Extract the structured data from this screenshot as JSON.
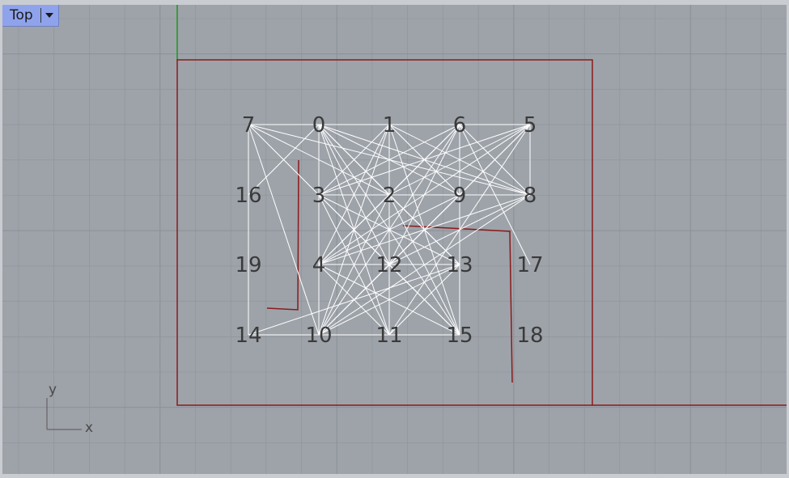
{
  "viewport": {
    "title": "Top",
    "menu_icon": "chevron-down-icon"
  },
  "axis_widget": {
    "x_label": "x",
    "y_label": "y"
  },
  "colors": {
    "background": "#9ea3aa",
    "grid": "#8d9299",
    "edges": "#ffffff",
    "curves": "#8b1a1a",
    "y_axis": "#3c9a3c"
  },
  "nodes": [
    {
      "id": "0",
      "label": "0"
    },
    {
      "id": "1",
      "label": "1"
    },
    {
      "id": "2",
      "label": "2"
    },
    {
      "id": "3",
      "label": "3"
    },
    {
      "id": "4",
      "label": "4"
    },
    {
      "id": "5",
      "label": "5"
    },
    {
      "id": "6",
      "label": "6"
    },
    {
      "id": "7",
      "label": "7"
    },
    {
      "id": "8",
      "label": "8"
    },
    {
      "id": "9",
      "label": "9"
    },
    {
      "id": "10",
      "label": "10"
    },
    {
      "id": "11",
      "label": "11"
    },
    {
      "id": "12",
      "label": "12"
    },
    {
      "id": "13",
      "label": "13"
    },
    {
      "id": "14",
      "label": "14"
    },
    {
      "id": "15",
      "label": "15"
    },
    {
      "id": "16",
      "label": "16"
    },
    {
      "id": "17",
      "label": "17"
    },
    {
      "id": "18",
      "label": "18"
    },
    {
      "id": "19",
      "label": "19"
    }
  ],
  "edges": [
    [
      "7",
      "0"
    ],
    [
      "0",
      "1"
    ],
    [
      "1",
      "6"
    ],
    [
      "6",
      "5"
    ],
    [
      "7",
      "10"
    ],
    [
      "7",
      "3"
    ],
    [
      "7",
      "2"
    ],
    [
      "7",
      "8"
    ],
    [
      "7",
      "14"
    ],
    [
      "0",
      "16"
    ],
    [
      "0",
      "3"
    ],
    [
      "0",
      "2"
    ],
    [
      "0",
      "9"
    ],
    [
      "0",
      "8"
    ],
    [
      "0",
      "12"
    ],
    [
      "0",
      "13"
    ],
    [
      "0",
      "11"
    ],
    [
      "0",
      "15"
    ],
    [
      "1",
      "3"
    ],
    [
      "1",
      "2"
    ],
    [
      "1",
      "9"
    ],
    [
      "1",
      "8"
    ],
    [
      "1",
      "12"
    ],
    [
      "1",
      "4"
    ],
    [
      "1",
      "10"
    ],
    [
      "1",
      "15"
    ],
    [
      "6",
      "3"
    ],
    [
      "6",
      "2"
    ],
    [
      "6",
      "9"
    ],
    [
      "6",
      "8"
    ],
    [
      "6",
      "4"
    ],
    [
      "6",
      "10"
    ],
    [
      "6",
      "12"
    ],
    [
      "6",
      "17"
    ],
    [
      "5",
      "3"
    ],
    [
      "5",
      "2"
    ],
    [
      "5",
      "9"
    ],
    [
      "5",
      "8"
    ],
    [
      "5",
      "4"
    ],
    [
      "5",
      "10"
    ],
    [
      "5",
      "11"
    ],
    [
      "3",
      "2"
    ],
    [
      "2",
      "9"
    ],
    [
      "9",
      "8"
    ],
    [
      "3",
      "8"
    ],
    [
      "3",
      "4"
    ],
    [
      "3",
      "12"
    ],
    [
      "3",
      "11"
    ],
    [
      "3",
      "15"
    ],
    [
      "3",
      "13"
    ],
    [
      "2",
      "4"
    ],
    [
      "2",
      "12"
    ],
    [
      "2",
      "10"
    ],
    [
      "2",
      "11"
    ],
    [
      "2",
      "15"
    ],
    [
      "2",
      "13"
    ],
    [
      "9",
      "4"
    ],
    [
      "9",
      "12"
    ],
    [
      "9",
      "10"
    ],
    [
      "9",
      "13"
    ],
    [
      "8",
      "4"
    ],
    [
      "8",
      "12"
    ],
    [
      "8",
      "10"
    ],
    [
      "4",
      "12"
    ],
    [
      "12",
      "13"
    ],
    [
      "4",
      "13"
    ],
    [
      "4",
      "10"
    ],
    [
      "4",
      "11"
    ],
    [
      "4",
      "15"
    ],
    [
      "12",
      "10"
    ],
    [
      "12",
      "11"
    ],
    [
      "12",
      "15"
    ],
    [
      "13",
      "10"
    ],
    [
      "13",
      "11"
    ],
    [
      "13",
      "15"
    ],
    [
      "13",
      "14"
    ],
    [
      "10",
      "11"
    ],
    [
      "11",
      "15"
    ],
    [
      "14",
      "10"
    ]
  ]
}
